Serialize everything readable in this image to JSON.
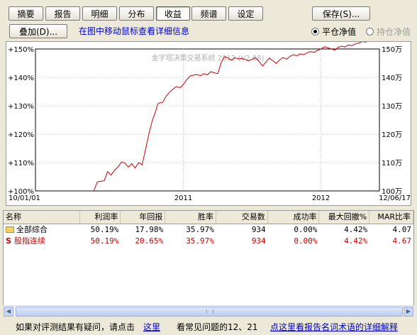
{
  "tabs": [
    {
      "label": "摘要",
      "active": false
    },
    {
      "label": "报告",
      "active": false
    },
    {
      "label": "明细",
      "active": false
    },
    {
      "label": "分布",
      "active": false
    },
    {
      "label": "收益",
      "active": true
    },
    {
      "label": "频谱",
      "active": false
    },
    {
      "label": "设定",
      "active": false
    }
  ],
  "toolbar": {
    "save_label": "保存(S)...",
    "overlay_label": "叠加(D)...",
    "hint": "在图中移动鼠标查看详细信息",
    "radio_close": "平仓净值",
    "radio_hold": "持仓净值"
  },
  "chart_data": {
    "type": "line",
    "watermark": "金字塔决策交易系统 2012 (V2.88)",
    "x_tick_labels": [
      "10/01/01",
      "2011",
      "2012",
      "12/06/17"
    ],
    "left_axis_labels": [
      "+150%",
      "+140%",
      "+130%",
      "+120%",
      "+110%",
      "+100%"
    ],
    "right_axis_labels": [
      "150万",
      "140万",
      "130万",
      "120万",
      "110万",
      "100万"
    ],
    "ylim": [
      100,
      150
    ],
    "grid": true,
    "series": [
      {
        "color": "#cc0000",
        "x": [
          0.17,
          0.18,
          0.19,
          0.2,
          0.21,
          0.22,
          0.23,
          0.24,
          0.25,
          0.26,
          0.27,
          0.28,
          0.29,
          0.3,
          0.31,
          0.32,
          0.33,
          0.34,
          0.35,
          0.355,
          0.36,
          0.37,
          0.38,
          0.39,
          0.4,
          0.41,
          0.42,
          0.43,
          0.44,
          0.45,
          0.46,
          0.47,
          0.48,
          0.49,
          0.5,
          0.51,
          0.52,
          0.53,
          0.54,
          0.55,
          0.56,
          0.57,
          0.58,
          0.59,
          0.6,
          0.61,
          0.62,
          0.63,
          0.64,
          0.65,
          0.66,
          0.67,
          0.68,
          0.69,
          0.7,
          0.71,
          0.72,
          0.73,
          0.74,
          0.75,
          0.76,
          0.77,
          0.78,
          0.79,
          0.8,
          0.81,
          0.82,
          0.83,
          0.84,
          0.85,
          0.86,
          0.87,
          0.88,
          0.89,
          0.9,
          0.91,
          0.92,
          0.93,
          0.94,
          0.95,
          0.96,
          0.97,
          0.98,
          0.99,
          1.0
        ],
        "y": [
          100.2,
          103.2,
          103.4,
          103.6,
          106.8,
          105.6,
          107.3,
          108.5,
          110.2,
          109.8,
          108.4,
          109.6,
          108.1,
          110.0,
          109.2,
          114.5,
          120.3,
          124.9,
          128.3,
          130.5,
          131.0,
          131.2,
          133.4,
          134.8,
          135.9,
          136.8,
          136.3,
          137.5,
          139.2,
          140.5,
          140.8,
          141.0,
          140.6,
          141.3,
          140.9,
          142.0,
          141.6,
          141.3,
          145.2,
          147.3,
          146.8,
          146.1,
          146.9,
          146.5,
          146.7,
          146.3,
          145.8,
          146.4,
          146.9,
          145.6,
          144.0,
          145.4,
          146.8,
          145.9,
          144.9,
          146.2,
          147.0,
          146.4,
          147.4,
          148.0,
          147.6,
          148.3,
          148.0,
          148.7,
          149.1,
          148.8,
          149.5,
          150.0,
          150.8,
          150.4,
          150.0,
          149.6,
          150.6,
          151.0,
          150.7,
          151.4,
          151.2,
          151.8,
          152.1,
          152.6,
          152.4,
          152.9,
          153.2,
          153.6,
          154.1
        ]
      }
    ]
  },
  "table": {
    "columns": [
      "名称",
      "利润率",
      "年回报",
      "胜率",
      "交易数",
      "成功率",
      "最大回撤%",
      "MAR比率"
    ],
    "rows": [
      {
        "icon": "folder-icon",
        "name": "全部综合",
        "values": [
          "50.19%",
          "17.98%",
          "35.97%",
          "934",
          "0.00%",
          "4.42%",
          "4.07"
        ],
        "color": "#000000"
      },
      {
        "icon": "s-strategy-icon",
        "name": "股指连续",
        "values": [
          "50.19%",
          "20.65%",
          "35.97%",
          "934",
          "0.00%",
          "4.42%",
          "4.67"
        ],
        "color": "#cc0000"
      }
    ]
  },
  "status": {
    "question_text": "如果对评测结果有疑问，请点击",
    "here_link": "这里",
    "faq_text": "看常见问题的12、21",
    "glossary_link": "点这里看报告名词术语的详细解释"
  }
}
